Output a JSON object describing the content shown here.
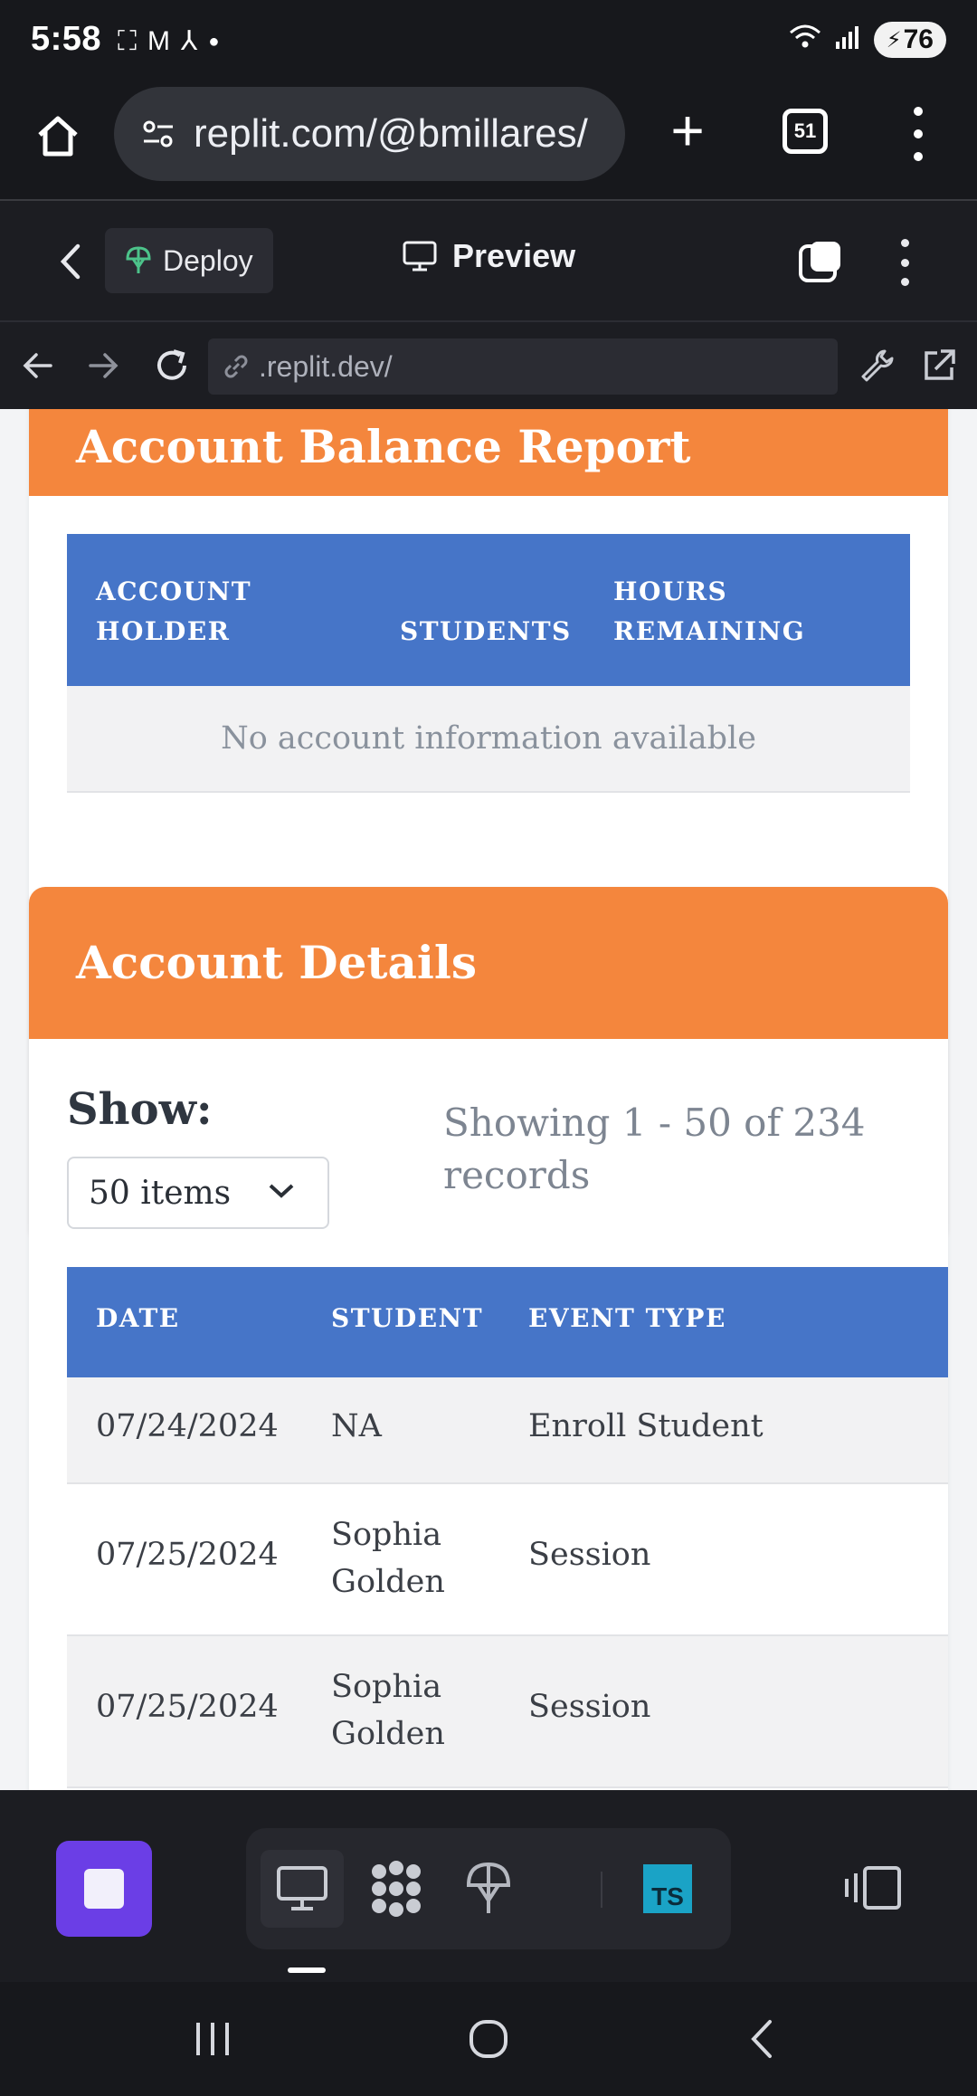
{
  "status_bar": {
    "time": "5:58",
    "left_icons": [
      "screenshot-icon",
      "gmail-icon",
      "acrobat-icon",
      "dot-icon"
    ],
    "battery": "76"
  },
  "browser": {
    "url": "replit.com/@bmillares/",
    "tab_count": "51"
  },
  "replit_toolbar": {
    "deploy_label": "Deploy",
    "preview_label": "Preview"
  },
  "webview": {
    "url": ".replit.dev/"
  },
  "balance_report": {
    "title": "Account Balance Report",
    "headers": [
      "ACCOUNT HOLDER",
      "STUDENTS",
      "HOURS REMAINING"
    ],
    "empty_message": "No account information available"
  },
  "account_details": {
    "title": "Account Details",
    "show_label": "Show:",
    "page_size": "50 items",
    "showing_text": "Showing 1 - 50 of 234 records",
    "headers": [
      "DATE",
      "STUDENT",
      "EVENT TYPE"
    ],
    "rows": [
      {
        "date": "07/24/2024",
        "student": "NA",
        "event": "Enroll Student"
      },
      {
        "date": "07/25/2024",
        "student": "Sophia Golden",
        "event": "Session"
      },
      {
        "date": "07/25/2024",
        "student": "Sophia Golden",
        "event": "Session"
      }
    ]
  },
  "colors": {
    "orange": "#f4863d",
    "table_blue": "#4675c8",
    "replit_purple": "#6b3ee6"
  }
}
